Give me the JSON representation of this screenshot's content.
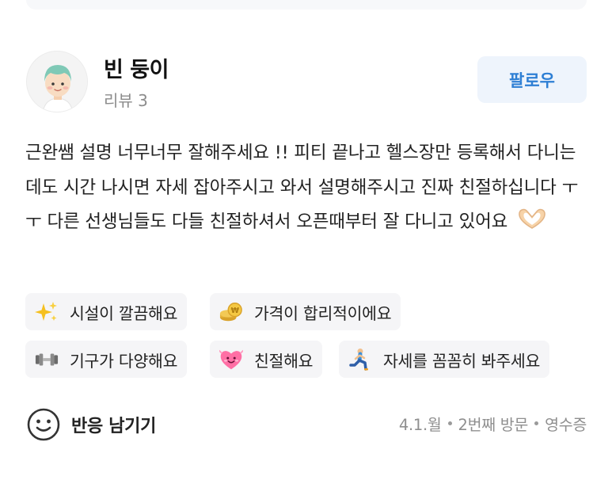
{
  "profile": {
    "name": "빈 둥이",
    "review_count": "리뷰 3",
    "follow_label": "팔로우"
  },
  "review": {
    "text": "근완쌤 설명 너무너무 잘해주세요 !! 피티 끝나고 헬스장만 등록해서 다니는데도 시간 나시면 자세 잡아주시고 와서 설명해주시고 진짜 친절하십니다 ㅜ ㅜ 다른 선생님들도 다들 친절하셔서 오픈때부터 잘 다니고 있어요"
  },
  "keywords": [
    {
      "label": "시설이 깔끔해요",
      "icon": "sparkles-icon"
    },
    {
      "label": "가격이 합리적이에요",
      "icon": "coins-icon"
    },
    {
      "label": "기구가 다양해요",
      "icon": "dumbbell-icon"
    },
    {
      "label": "친절해요",
      "icon": "heart-icon"
    },
    {
      "label": "자세를 꼼꼼히 봐주세요",
      "icon": "lunge-person-icon"
    }
  ],
  "footer": {
    "react_label": "반응 남기기",
    "date": "4.1.월",
    "visit": "2번째 방문",
    "receipt": "영수증"
  },
  "colors": {
    "accent": "#2e7fd4",
    "follow_bg": "#eef4fc",
    "chip_bg": "#f5f5f7",
    "muted": "#8c8c8c"
  }
}
